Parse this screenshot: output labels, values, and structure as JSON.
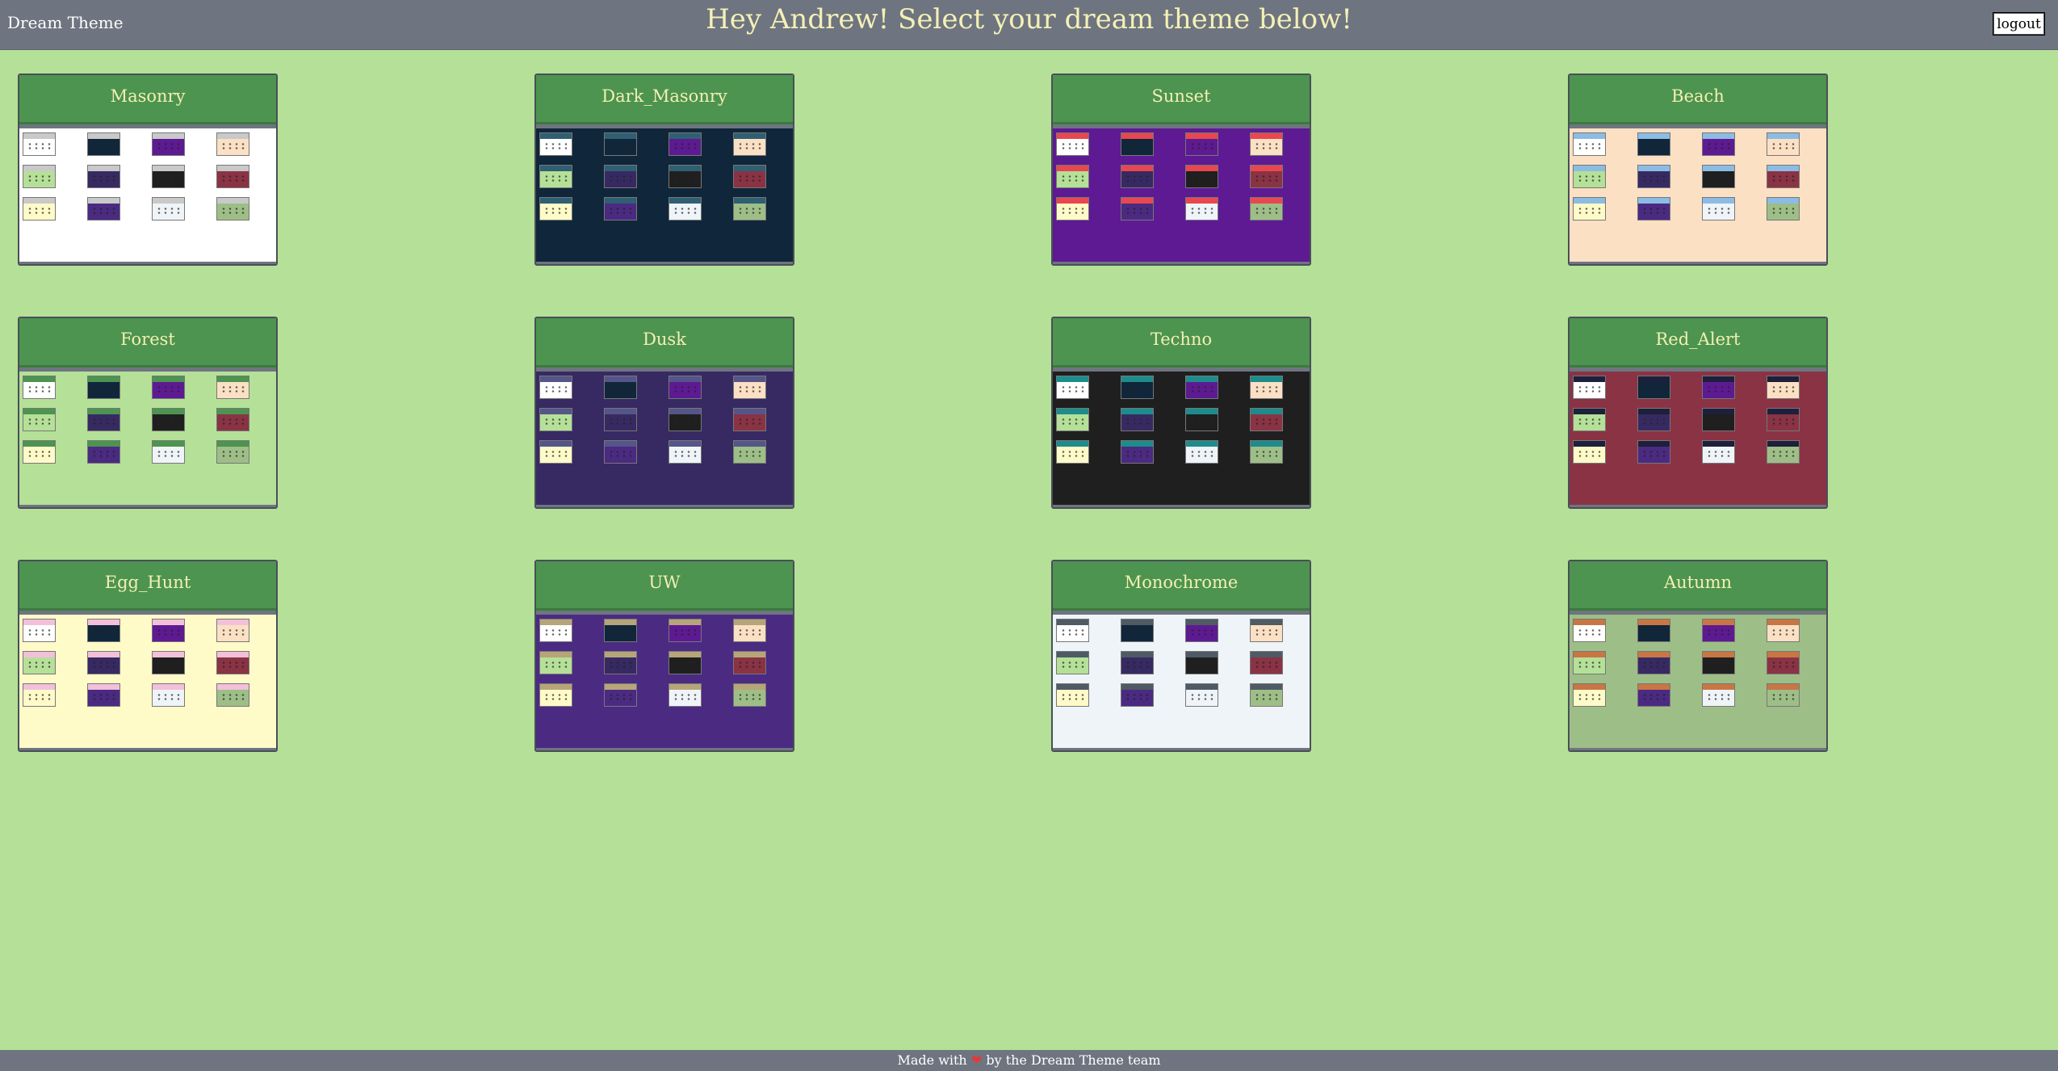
{
  "app": {
    "brand": "Dream Theme",
    "headline": "Hey Andrew! Select your dream theme below!",
    "logout_label": "logout"
  },
  "footer": {
    "text_before": "Made with",
    "heart_icon": "heart-icon",
    "text_after": "by the Dream Theme team"
  },
  "colors": {
    "page_background": "#b5e098",
    "bar_background": "#6e7580",
    "card_header": "#4c944f",
    "card_header_text": "#f4efb4"
  },
  "themes": [
    {
      "name": "Masonry",
      "bg": "#ffffff",
      "accent": "#c9c9c9"
    },
    {
      "name": "Dark_Masonry",
      "bg": "#10263a",
      "accent": "#2f5f73"
    },
    {
      "name": "Sunset",
      "bg": "#5e1a92",
      "accent": "#e8474f"
    },
    {
      "name": "Beach",
      "bg": "#fbe0c4",
      "accent": "#8cbce4"
    },
    {
      "name": "Forest",
      "bg": "#b5e098",
      "accent": "#4c944f"
    },
    {
      "name": "Dusk",
      "bg": "#372a62",
      "accent": "#55558a"
    },
    {
      "name": "Techno",
      "bg": "#1f1f1f",
      "accent": "#1c8d8c"
    },
    {
      "name": "Red_Alert",
      "bg": "#8a3344",
      "accent": "#1d1f3b"
    },
    {
      "name": "Egg_Hunt",
      "bg": "#fffbc9",
      "accent": "#f3c0d9"
    },
    {
      "name": "UW",
      "bg": "#4b2a82",
      "accent": "#b7a57a"
    },
    {
      "name": "Monochrome",
      "bg": "#eff4f8",
      "accent": "#4f5a64"
    },
    {
      "name": "Autumn",
      "bg": "#9ebe87",
      "accent": "#c97645"
    }
  ]
}
